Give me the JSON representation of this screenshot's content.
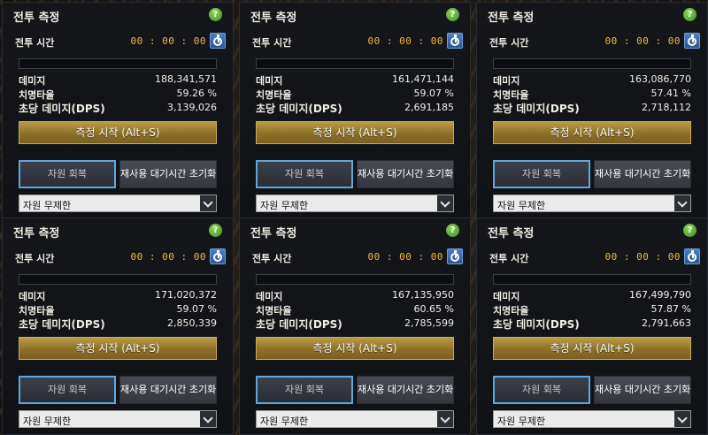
{
  "common": {
    "title": "전투 측정",
    "help_symbol": "?",
    "time_label": "전투 시간",
    "damage_label": "데미지",
    "crit_label": "치명타율",
    "dps_label": "초당 데미지(DPS)",
    "start_label": "측정 시작 (Alt+S)",
    "recover_label": "자원 회복",
    "reset_label": "재사용 대기시간 초기화",
    "select_value": "자원 무제한"
  },
  "panels": [
    {
      "time": "00 : 00 : 00",
      "damage": "188,341,571",
      "crit": "59.26 %",
      "dps": "3,139,026"
    },
    {
      "time": "00 : 00 : 00",
      "damage": "161,471,144",
      "crit": "59.07 %",
      "dps": "2,691,185"
    },
    {
      "time": "00 : 00 : 00",
      "damage": "163,086,770",
      "crit": "57.41 %",
      "dps": "2,718,112"
    },
    {
      "time": "00 : 00 : 00",
      "damage": "171,020,372",
      "crit": "59.07 %",
      "dps": "2,850,339"
    },
    {
      "time": "00 : 00 : 00",
      "damage": "167,135,950",
      "crit": "60.65 %",
      "dps": "2,785,599"
    },
    {
      "time": "00 : 00 : 00",
      "damage": "167,499,790",
      "crit": "57.87 %",
      "dps": "2,791,663"
    }
  ]
}
